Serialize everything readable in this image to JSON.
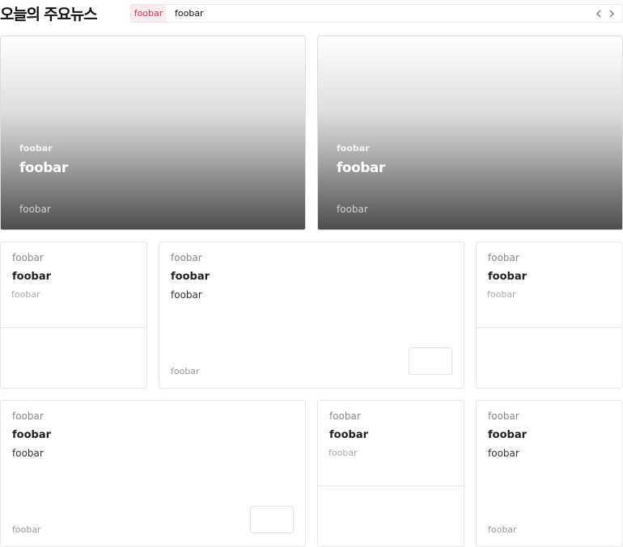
{
  "header": {
    "title": "오늘의 주요뉴스",
    "ticker": {
      "tag": "foobar",
      "text": "foobar",
      "prev_icon": "chevron-left-icon",
      "next_icon": "chevron-right-icon"
    }
  },
  "heroes": [
    {
      "category": "foobar",
      "title": "foobar",
      "source": "foobar"
    },
    {
      "category": "foobar",
      "title": "foobar",
      "source": "foobar"
    }
  ],
  "row1": [
    {
      "category": "foobar",
      "title": "foobar",
      "subtitle": "foobar"
    },
    {
      "category": "foobar",
      "title": "foobar",
      "description": "foobar",
      "source": "foobar"
    },
    {
      "category": "foobar",
      "title": "foobar",
      "subtitle": "foobar"
    }
  ],
  "row2": [
    {
      "category": "foobar",
      "title": "foobar",
      "description": "foobar",
      "source": "foobar"
    },
    {
      "category": "foobar",
      "title": "foobar",
      "subtitle": "foobar"
    },
    {
      "category": "foobar",
      "title": "foobar",
      "description": "foobar",
      "source": "foobar"
    }
  ],
  "colors": {
    "accent": "#e0315a",
    "accent_bg": "#fdecef",
    "border": "#e6e6e6"
  }
}
